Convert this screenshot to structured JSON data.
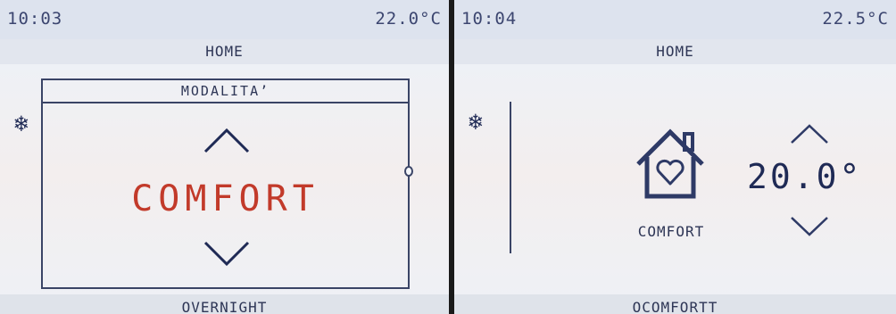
{
  "left_screen": {
    "clock": "10:03",
    "temperature": "22.0°C",
    "header": "HOME",
    "snowflake_icon": "snowflake-icon",
    "modal": {
      "title": "MODALITA’",
      "value": "COMFORT",
      "up_icon": "chevron-up-icon",
      "down_icon": "chevron-down-icon"
    },
    "footer": "OVERNIGHT"
  },
  "right_screen": {
    "clock": "10:04",
    "temperature": "22.5°C",
    "header": "HOME",
    "snowflake_icon": "snowflake-icon",
    "mode_icon": "home-heart-icon",
    "mode_label": "COMFORT",
    "setpoint": "20.0°",
    "up_icon": "chevron-up-icon",
    "down_icon": "chevron-down-icon",
    "footer": "OCOMFORTT"
  },
  "colors": {
    "accent_red": "#c23a2a",
    "text_dark": "#2e3656",
    "bar_bg": "#dde3ee"
  }
}
